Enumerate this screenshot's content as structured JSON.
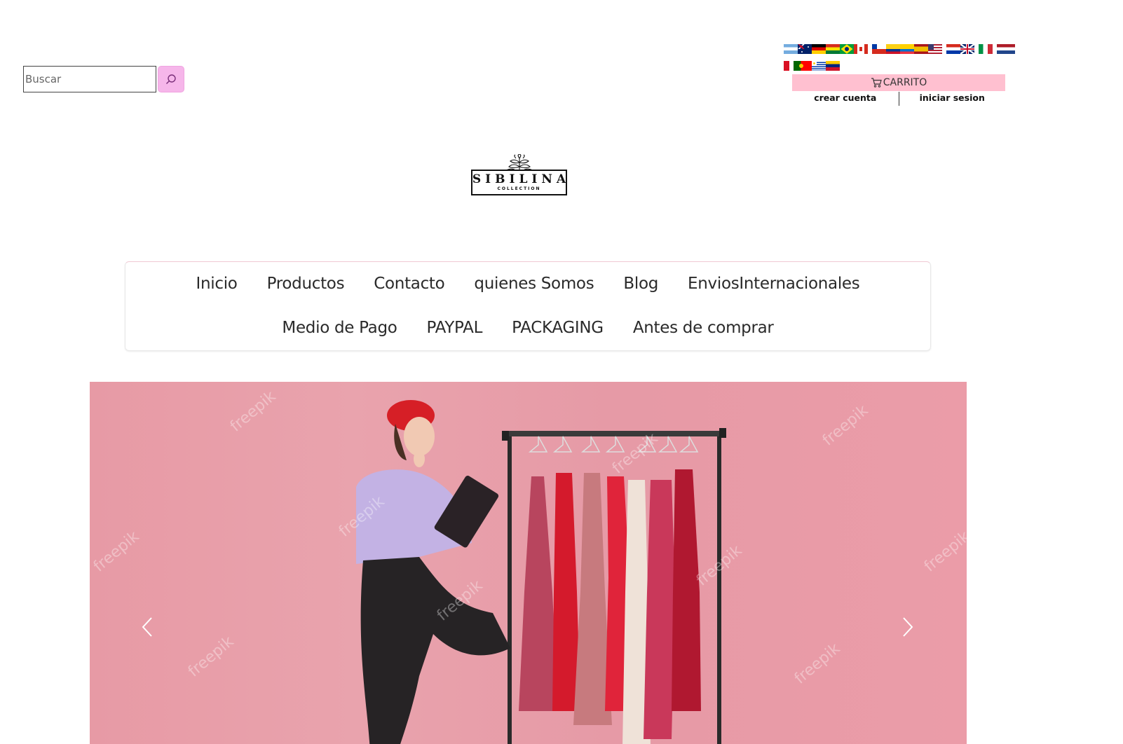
{
  "search": {
    "placeholder": "Buscar",
    "value": ""
  },
  "flags": {
    "row1": [
      "ar",
      "au",
      "de",
      "bo",
      "br",
      "ca",
      "cl",
      "co",
      "ec",
      "es",
      "us",
      "py",
      "gb",
      "it",
      "nl"
    ],
    "row2": [
      "pe",
      "pt",
      "uy",
      "ve"
    ]
  },
  "cart": {
    "label": "CARRITO"
  },
  "account": {
    "create": "crear cuenta",
    "login": "iniciar sesion"
  },
  "logo": {
    "name": "SIBILINA",
    "sub": "COLLECTION"
  },
  "nav": {
    "row1": [
      "Inicio",
      "Productos",
      "Contacto",
      "quienes Somos",
      "Blog",
      "EnviosInternacionales"
    ],
    "row2": [
      "Medio de Pago",
      "PAYPAL",
      "PACKAGING",
      "Antes de comprar"
    ]
  },
  "carousel": {
    "watermark": "freepik"
  },
  "colors": {
    "accent_pink": "#f6b6ea",
    "cart_pink": "#ffc0d0",
    "hero_bg": "#e89ba6"
  }
}
